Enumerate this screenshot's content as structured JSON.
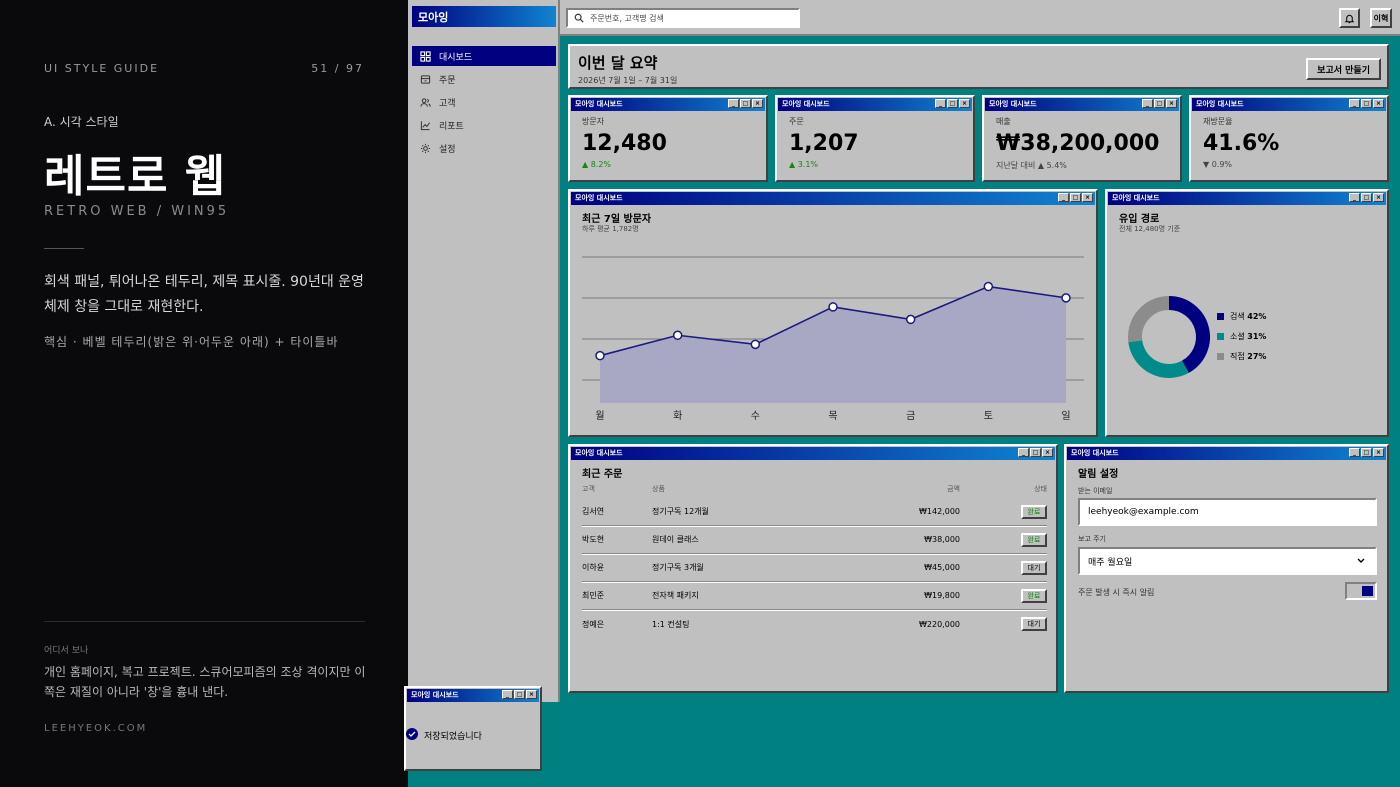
{
  "guide": {
    "label": "UI STYLE GUIDE",
    "page": "51 / 97",
    "section": "A. 시각 스타일",
    "title": "레트로 웹",
    "subtitle": "RETRO WEB / WIN95",
    "description": "회색 패널, 튀어나온 테두리, 제목 표시줄. 90년대 운영체제 창을 그대로 재현한다.",
    "core": "핵심 · 베벨 테두리(밝은 위·어두운 아래) + 타이틀바",
    "where_label": "어디서 보나",
    "where_text": "개인 홈페이지, 복고 프로젝트. 스큐어모피즘의 조상 격이지만 이쪽은 재질이 아니라 '창'을 흉내 낸다.",
    "site": "LEEHYEOK.COM"
  },
  "app": {
    "name": "모아잉",
    "window_title": "모아잉 대시보드",
    "colors": {
      "title_start": "#000080",
      "title_end": "#1084d0",
      "desktop": "#008080",
      "panel": "#c0c0c0",
      "teal": "#008b8b",
      "gray": "#8c8c8c"
    }
  },
  "sidebar": {
    "items": [
      {
        "label": "대시보드",
        "icon": "grid-icon",
        "active": true
      },
      {
        "label": "주문",
        "icon": "box-icon",
        "active": false
      },
      {
        "label": "고객",
        "icon": "users-icon",
        "active": false
      },
      {
        "label": "리포트",
        "icon": "chart-icon",
        "active": false
      },
      {
        "label": "설정",
        "icon": "gear-icon",
        "active": false
      }
    ]
  },
  "topbar": {
    "search_placeholder": "주문번호, 고객명 검색",
    "bell_icon": "bell-icon",
    "user": "이혁"
  },
  "summary": {
    "title": "이번 달 요약",
    "date_range": "2026년 7월 1일 – 7월 31일",
    "report_button": "보고서 만들기"
  },
  "kpis": [
    {
      "label": "방문자",
      "value": "12,480",
      "change": "▲ 8.2%",
      "trend": "up"
    },
    {
      "label": "주문",
      "value": "1,207",
      "change": "▲ 3.1%",
      "trend": "up"
    },
    {
      "label": "매출",
      "value": "₩38,200,000",
      "change": "지난달 대비 ▲ 5.4%",
      "trend": "neutral"
    },
    {
      "label": "재방문율",
      "value": "41.6%",
      "change": "▼ 0.9%",
      "trend": "down"
    }
  ],
  "visitors_panel": {
    "title": "최근 7일 방문자",
    "subtitle": "하루 평균 1,782명"
  },
  "source_panel": {
    "title": "유입 경로",
    "subtitle": "전체 12,480명 기준"
  },
  "chart_data": [
    {
      "type": "area",
      "title": "최근 7일 방문자",
      "categories": [
        "월",
        "화",
        "수",
        "목",
        "금",
        "토",
        "일"
      ],
      "values": [
        1500,
        1680,
        1600,
        1930,
        1820,
        2110,
        2010
      ],
      "ylim": [
        1100,
        2300
      ],
      "grid": true
    },
    {
      "type": "pie",
      "title": "유입 경로",
      "labels": [
        "검색",
        "소셜",
        "직접"
      ],
      "values": [
        42,
        31,
        27
      ],
      "colors": [
        "#000080",
        "#008b8b",
        "#8c8c8c"
      ],
      "legend": "right",
      "legend_values": [
        "42%",
        "31%",
        "27%"
      ]
    }
  ],
  "orders": {
    "title": "최근 주문",
    "headers": [
      "고객",
      "상품",
      "금액",
      "상태"
    ],
    "rows": [
      {
        "customer": "김서연",
        "product": "정기구독 12개월",
        "amount": "₩142,000",
        "status": "완료",
        "ok": true
      },
      {
        "customer": "박도현",
        "product": "원데이 클래스",
        "amount": "₩38,000",
        "status": "완료",
        "ok": true
      },
      {
        "customer": "이하윤",
        "product": "정기구독 3개월",
        "amount": "₩45,000",
        "status": "대기",
        "ok": false
      },
      {
        "customer": "최민준",
        "product": "전자책 패키지",
        "amount": "₩19,800",
        "status": "완료",
        "ok": true
      },
      {
        "customer": "정예은",
        "product": "1:1 컨설팅",
        "amount": "₩220,000",
        "status": "대기",
        "ok": false
      }
    ]
  },
  "alerts": {
    "title": "알림 설정",
    "email_label": "받는 이메일",
    "email_value": "leehyeok@example.com",
    "period_label": "보고 주기",
    "period_value": "매주 월요일",
    "instant_label": "주문 발생 시 즉시 알림"
  },
  "toast": {
    "message": "저장되었습니다"
  }
}
